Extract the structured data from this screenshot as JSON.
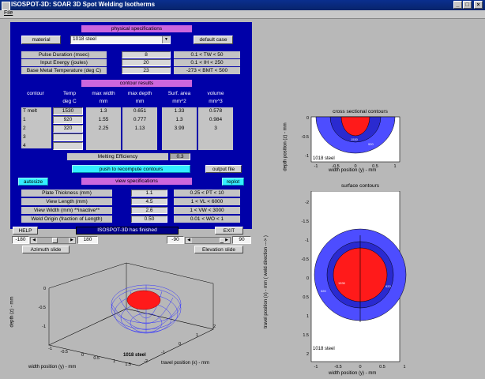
{
  "window": {
    "title": "ISOSPOT-3D: SOAR 3D Spot Welding Isotherms"
  },
  "menu": {
    "file": "File"
  },
  "physical": {
    "header": "physical specifications",
    "material_button": "material",
    "material_value": "1018 steel",
    "default_button": "default case",
    "rows": [
      {
        "label": "Pulse Duration (msec)",
        "value": "8",
        "range": "0.1 < TW < 50"
      },
      {
        "label": "Input Energy (joules)",
        "value": "20",
        "range": "0.1 < IH < 250"
      },
      {
        "label": "Base Metal Temperature (deg C)",
        "value": "23",
        "range": "-273 < BMT < 500"
      }
    ]
  },
  "contour": {
    "header": "contour results",
    "headers": [
      "contour",
      "Temp",
      "max width",
      "max depth",
      "Surf. area",
      "volume"
    ],
    "units": [
      "",
      "deg C",
      "mm",
      "mm",
      "mm^2",
      "mm^3"
    ],
    "labels": [
      "T melt",
      "1",
      "2",
      "3",
      "4"
    ],
    "temps": [
      "1530",
      "920",
      "320",
      "",
      ""
    ],
    "widths": [
      "1.3",
      "1.55",
      "2.25"
    ],
    "depths": [
      "0.651",
      "0.777",
      "1.13"
    ],
    "areas": [
      "1.33",
      "1.3",
      "3.99"
    ],
    "volumes": [
      "0.578",
      "0.984",
      "3"
    ],
    "melting_label": "Melting Efficiency",
    "melting_value": "0.3",
    "recompute": "push to recompute contours",
    "output": "output file"
  },
  "view": {
    "header": "view specifications",
    "autosize": "autosize",
    "replot": "replot",
    "rows": [
      {
        "label": "Plate Thickness  (mm)",
        "value": "1.1",
        "range": "0.25 < PT < 10"
      },
      {
        "label": "View Length  (mm)",
        "value": "4.5",
        "range": "1 < VL < 6000"
      },
      {
        "label": "View Width  (mm) **inactive**",
        "value": "2.6",
        "range": "1 < VW < 3000"
      },
      {
        "label": "Weld Origin (fraction of Length)",
        "value": "0.50",
        "range": "0.01 < WO < 1"
      }
    ]
  },
  "controls": {
    "help": "HELP",
    "status": "ISOSPOT-3D has finished",
    "exit": "EXIT",
    "az_min": "-180",
    "az_value": "180",
    "az_label": "Azimuth slide",
    "el_min": "-90",
    "el_value": "90",
    "el_label": "Elevation slide"
  },
  "cross": {
    "title": "cross sectional contours",
    "xlabel": "width position (y) - mm",
    "ylabel": "depth position (z) - mm",
    "material": "1018 steel",
    "xticks": [
      "-1",
      "-0.5",
      "0",
      "0.5",
      "1"
    ],
    "yticks": [
      "0",
      "-0.5",
      "-1"
    ],
    "iso_labels": [
      "1530",
      "920"
    ]
  },
  "surface": {
    "title": "surface contours",
    "xlabel": "width position (y) - mm",
    "ylabel": "travel position (x) - mm  ( weld direction ---> )",
    "material": "1018 steel",
    "xticks": [
      "-1",
      "-0.5",
      "0",
      "0.5",
      "1"
    ],
    "yticks": [
      "-2",
      "-1.5",
      "-1",
      "-0.5",
      "0",
      "0.5",
      "1",
      "1.5",
      "2"
    ],
    "iso_labels": [
      "1530",
      "920",
      "320"
    ]
  },
  "view3d": {
    "xlabel": "travel position (x) - mm",
    "ylabel": "width position (y) - mm",
    "zlabel": "depth (z) - mm",
    "material": "1018 steel",
    "zticks": [
      "0",
      "-0.5",
      "-1"
    ],
    "yticks": [
      "-1",
      "-0.5",
      "0",
      "0.5",
      "1",
      "1.5"
    ],
    "xticks": [
      "-2",
      "-1",
      "0",
      "1",
      "2"
    ]
  },
  "colors": {
    "melt": "#ff1a1a",
    "iso1": "#4d4dff",
    "iso2": "#2a2ad0",
    "panel": "#0000a8"
  }
}
